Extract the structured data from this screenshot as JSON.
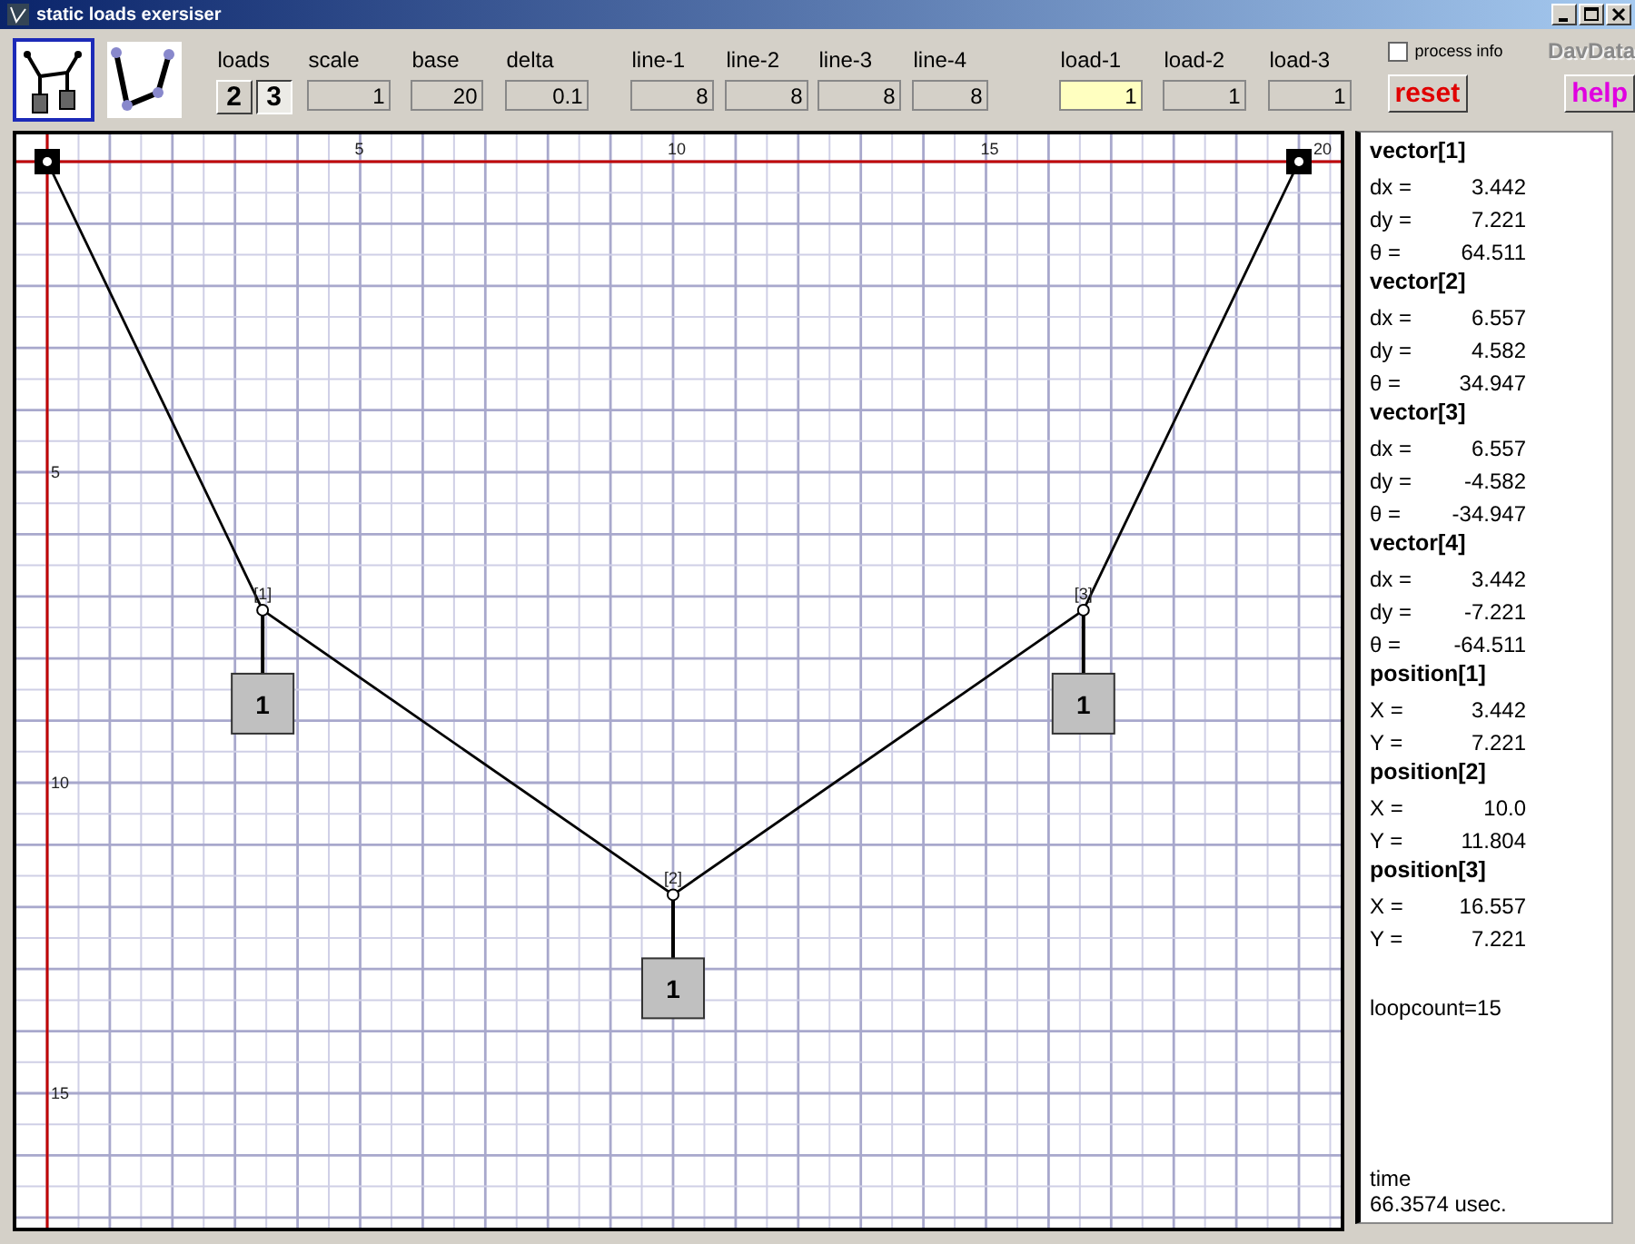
{
  "window": {
    "title": "static loads exersiser"
  },
  "mode_icons": [
    {
      "kind": "hanging-loads",
      "selected": true
    },
    {
      "kind": "chain",
      "selected": false
    }
  ],
  "loads": {
    "label": "loads",
    "options": [
      {
        "label": "2",
        "selected": false
      },
      {
        "label": "3",
        "selected": true
      }
    ]
  },
  "fields": [
    {
      "label": "scale",
      "value": "1",
      "highlighted": false
    },
    {
      "label": "base",
      "value": "20",
      "highlighted": false
    },
    {
      "label": "delta",
      "value": "0.1",
      "highlighted": false
    },
    {
      "label": "line-1",
      "value": "8",
      "highlighted": false
    },
    {
      "label": "line-2",
      "value": "8",
      "highlighted": false
    },
    {
      "label": "line-3",
      "value": "8",
      "highlighted": false
    },
    {
      "label": "line-4",
      "value": "8",
      "highlighted": false
    },
    {
      "label": "load-1",
      "value": "1",
      "highlighted": true
    },
    {
      "label": "load-2",
      "value": "1",
      "highlighted": false
    },
    {
      "label": "load-3",
      "value": "1",
      "highlighted": false
    }
  ],
  "process_info": {
    "label": "process info",
    "checked": false
  },
  "logo": "DavData",
  "buttons": [
    {
      "label": "reset",
      "kind": "reset"
    },
    {
      "label": "help",
      "kind": "help"
    }
  ],
  "diagram": {
    "x_labels": [
      "5",
      "10",
      "15",
      "20"
    ],
    "y_labels": [
      "5",
      "10",
      "15"
    ],
    "nodes": [
      {
        "label": "[1]",
        "load": "1"
      },
      {
        "label": "[2]",
        "load": "1"
      },
      {
        "label": "[3]",
        "load": "1"
      }
    ]
  },
  "readout": {
    "sections": [
      {
        "title": "vector[1]",
        "rows": [
          {
            "name": "dx =",
            "value": "3.442"
          },
          {
            "name": "dy =",
            "value": "7.221"
          },
          {
            "name": "θ  =",
            "value": "64.511"
          }
        ]
      },
      {
        "title": "vector[2]",
        "rows": [
          {
            "name": "dx =",
            "value": "6.557"
          },
          {
            "name": "dy =",
            "value": "4.582"
          },
          {
            "name": "θ  =",
            "value": "34.947"
          }
        ]
      },
      {
        "title": "vector[3]",
        "rows": [
          {
            "name": "dx =",
            "value": "6.557"
          },
          {
            "name": "dy =",
            "value": "-4.582"
          },
          {
            "name": "θ  =",
            "value": "-34.947"
          }
        ]
      },
      {
        "title": "vector[4]",
        "rows": [
          {
            "name": "dx =",
            "value": "3.442"
          },
          {
            "name": "dy =",
            "value": "-7.221"
          },
          {
            "name": "θ  =",
            "value": "-64.511"
          }
        ]
      },
      {
        "title": "position[1]",
        "rows": [
          {
            "name": "X =",
            "value": "3.442"
          },
          {
            "name": "Y =",
            "value": "7.221"
          }
        ]
      },
      {
        "title": "position[2]",
        "rows": [
          {
            "name": "X =",
            "value": "10.0"
          },
          {
            "name": "Y =",
            "value": "11.804"
          }
        ]
      },
      {
        "title": "position[3]",
        "rows": [
          {
            "name": "X =",
            "value": "16.557"
          },
          {
            "name": "Y =",
            "value": "7.221"
          }
        ]
      }
    ],
    "loopcount": "loopcount=15",
    "time_label": "time",
    "time_value": "66.3574 usec."
  }
}
